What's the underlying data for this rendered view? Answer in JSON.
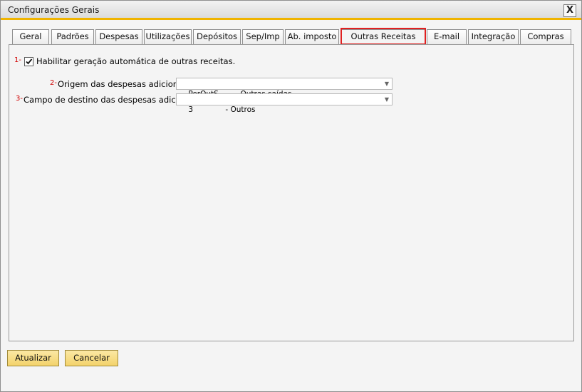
{
  "window": {
    "title": "Configurações Gerais",
    "close_label": "X"
  },
  "tabs": [
    {
      "label": "Geral"
    },
    {
      "label": "Padrões"
    },
    {
      "label": "Despesas"
    },
    {
      "label": "Utilizações"
    },
    {
      "label": "Depósitos"
    },
    {
      "label": "Sep/Imp"
    },
    {
      "label": "Ab. imposto"
    },
    {
      "label": "Outras Receitas",
      "active": true
    },
    {
      "label": "E-mail"
    },
    {
      "label": "Integração"
    },
    {
      "label": "Compras"
    }
  ],
  "markers": {
    "m1": "1-",
    "m2": "2-",
    "m3": "3-"
  },
  "options": {
    "enable_auto": {
      "label": "Habilitar geração automática de outras receitas.",
      "checked": true
    },
    "origin": {
      "label": "Origem das despesas adicionais:",
      "code": "PerOutS",
      "description": "- Outras saídas"
    },
    "destination": {
      "label": "Campo de destino das despesas adicionais:",
      "code": "3",
      "description": "- Outros"
    }
  },
  "buttons": {
    "update": "Atualizar",
    "cancel": "Cancelar"
  },
  "colors": {
    "accent": "#f0b400",
    "highlight": "#e02020",
    "button": "#f3d36b"
  }
}
